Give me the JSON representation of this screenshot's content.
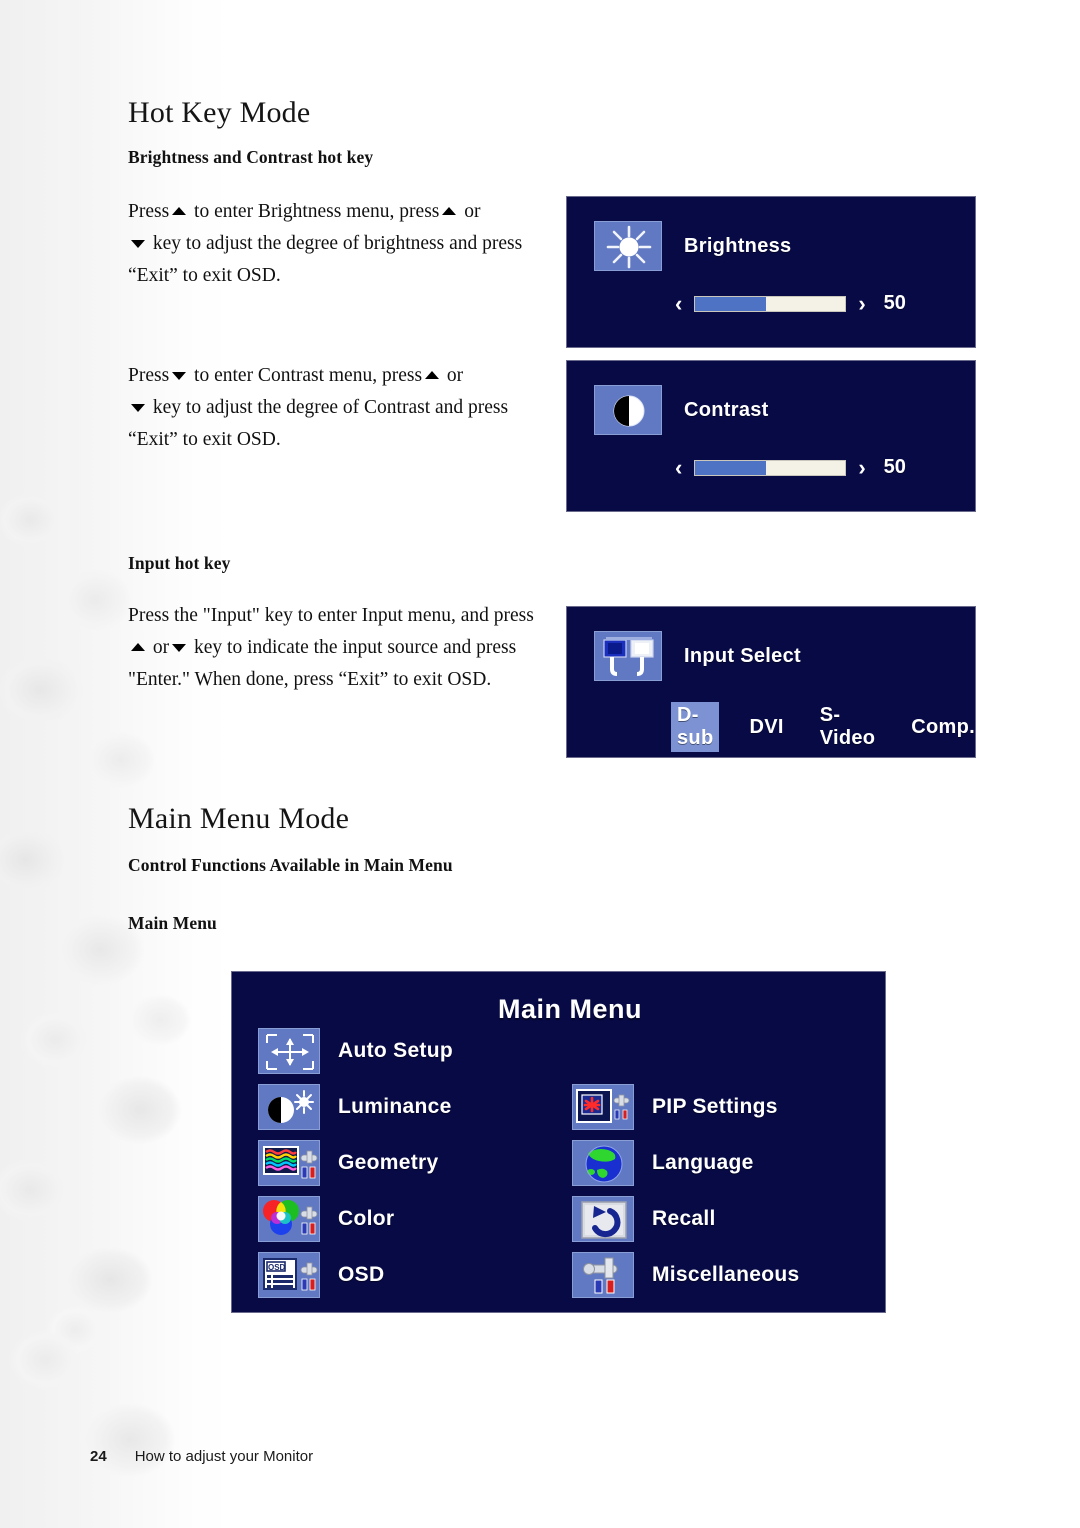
{
  "page": {
    "number": "24",
    "footer_text": "How to adjust your Monitor"
  },
  "sections": {
    "hot_key_mode": {
      "title": "Hot Key Mode",
      "brightness_contrast_heading": "Brightness and Contrast hot key",
      "brightness_text_a": "Press",
      "brightness_text_b": "to enter Brightness menu, press",
      "brightness_text_c": "or",
      "brightness_text_d": "key to adjust the degree of brightness and press “Exit” to exit OSD.",
      "contrast_text_a": "Press",
      "contrast_text_b": "to enter Contrast menu, press",
      "contrast_text_c": "or",
      "contrast_text_d": "key to adjust the degree of Contrast and press “Exit” to exit OSD.",
      "input_heading": "Input hot key",
      "input_text_a": "Press the \"Input\" key to enter Input menu, and press",
      "input_text_b": "or",
      "input_text_c": "key to indicate the input source and press \"Enter.\" When done, press “Exit” to exit OSD."
    },
    "main_menu_mode": {
      "title": "Main Menu Mode",
      "control_functions_heading": "Control Functions Available in Main Menu",
      "main_menu_heading": "Main Menu"
    }
  },
  "osd": {
    "brightness": {
      "label": "Brightness",
      "value": "50",
      "fill_percent": 47,
      "icon": "sun-icon",
      "left_chevron": "‹",
      "right_chevron": "›"
    },
    "contrast": {
      "label": "Contrast",
      "value": "50",
      "fill_percent": 47,
      "icon": "contrast-circle-icon",
      "left_chevron": "‹",
      "right_chevron": "›"
    },
    "input_select": {
      "label": "Input Select",
      "icon": "connector-plugs-icon",
      "options": [
        {
          "label": "D-sub",
          "selected": true
        },
        {
          "label": "DVI",
          "selected": false
        },
        {
          "label": "S-Video",
          "selected": false
        },
        {
          "label": "Comp.",
          "selected": false
        }
      ]
    },
    "main_menu": {
      "title": "Main Menu",
      "left_items": [
        {
          "label": "Auto Setup",
          "icon": "auto-setup-icon"
        },
        {
          "label": "Luminance",
          "icon": "luminance-icon"
        },
        {
          "label": "Geometry",
          "icon": "geometry-icon"
        },
        {
          "label": "Color",
          "icon": "color-icon"
        },
        {
          "label": "OSD",
          "icon": "osd-icon"
        }
      ],
      "right_items": [
        {
          "label": "PIP Settings",
          "icon": "pip-settings-icon"
        },
        {
          "label": "Language",
          "icon": "globe-icon"
        },
        {
          "label": "Recall",
          "icon": "recall-arrow-icon"
        },
        {
          "label": "Miscellaneous",
          "icon": "wrench-icon"
        }
      ]
    }
  },
  "colors": {
    "osd_background": "#080a46",
    "osd_tile": "#6179c2",
    "slider_fill": "#4e72c4",
    "slider_track": "#f4f1e6",
    "highlight": "#7d92d2",
    "text_white": "#ffffff"
  }
}
